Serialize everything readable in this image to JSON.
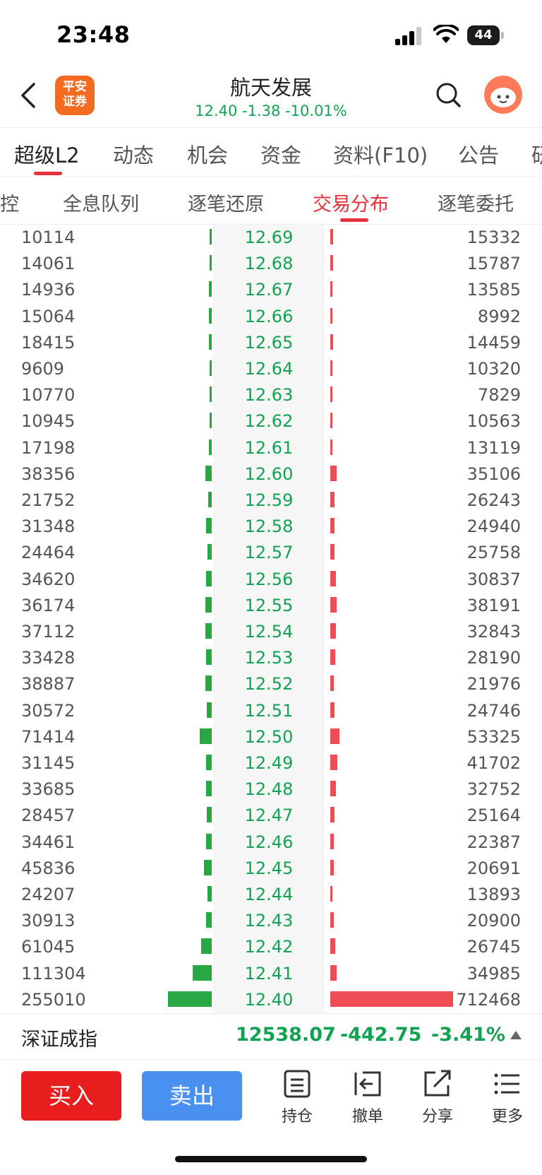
{
  "status_bar": {
    "time": "23:48",
    "battery": "44"
  },
  "header": {
    "logo_line1": "平安",
    "logo_line2": "证券",
    "title": "航天发展",
    "subtitle": "12.40 -1.38 -10.01%"
  },
  "tabs_primary": [
    "超级L2",
    "动态",
    "机会",
    "资金",
    "资料(F10)",
    "公告",
    "研"
  ],
  "tabs_secondary": [
    "控",
    "全息队列",
    "逐笔还原",
    "交易分布",
    "逐笔委托"
  ],
  "distribution": {
    "rows": [
      {
        "buy": "10114",
        "price": "12.69",
        "sell": "15332"
      },
      {
        "buy": "14061",
        "price": "12.68",
        "sell": "15787"
      },
      {
        "buy": "14936",
        "price": "12.67",
        "sell": "13585"
      },
      {
        "buy": "15064",
        "price": "12.66",
        "sell": "8992"
      },
      {
        "buy": "18415",
        "price": "12.65",
        "sell": "14459"
      },
      {
        "buy": "9609",
        "price": "12.64",
        "sell": "10320"
      },
      {
        "buy": "10770",
        "price": "12.63",
        "sell": "7829"
      },
      {
        "buy": "10945",
        "price": "12.62",
        "sell": "10563"
      },
      {
        "buy": "17198",
        "price": "12.61",
        "sell": "13119"
      },
      {
        "buy": "38356",
        "price": "12.60",
        "sell": "35106"
      },
      {
        "buy": "21752",
        "price": "12.59",
        "sell": "26243"
      },
      {
        "buy": "31348",
        "price": "12.58",
        "sell": "24940"
      },
      {
        "buy": "24464",
        "price": "12.57",
        "sell": "25758"
      },
      {
        "buy": "34620",
        "price": "12.56",
        "sell": "30837"
      },
      {
        "buy": "36174",
        "price": "12.55",
        "sell": "38191"
      },
      {
        "buy": "37112",
        "price": "12.54",
        "sell": "32843"
      },
      {
        "buy": "33428",
        "price": "12.53",
        "sell": "28190"
      },
      {
        "buy": "38887",
        "price": "12.52",
        "sell": "21976"
      },
      {
        "buy": "30572",
        "price": "12.51",
        "sell": "24746"
      },
      {
        "buy": "71414",
        "price": "12.50",
        "sell": "53325"
      },
      {
        "buy": "31145",
        "price": "12.49",
        "sell": "41702"
      },
      {
        "buy": "33685",
        "price": "12.48",
        "sell": "32752"
      },
      {
        "buy": "28457",
        "price": "12.47",
        "sell": "25164"
      },
      {
        "buy": "34461",
        "price": "12.46",
        "sell": "22387"
      },
      {
        "buy": "45836",
        "price": "12.45",
        "sell": "20691"
      },
      {
        "buy": "24207",
        "price": "12.44",
        "sell": "13893"
      },
      {
        "buy": "30913",
        "price": "12.43",
        "sell": "20900"
      },
      {
        "buy": "61045",
        "price": "12.42",
        "sell": "26745"
      },
      {
        "buy": "111304",
        "price": "12.41",
        "sell": "34985"
      },
      {
        "buy": "255010",
        "price": "12.40",
        "sell": "712468"
      }
    ],
    "colors": {
      "buy_bar": "#29a745",
      "sell_bar": "#ee4d55",
      "price": "#13a154"
    }
  },
  "index_bar": {
    "name": "深证成指",
    "value": "12538.07",
    "change": "-442.75",
    "change_pct": "-3.41%"
  },
  "toolbar": {
    "buy_label": "买入",
    "sell_label": "卖出",
    "hold_label": "持仓",
    "cancel_label": "撤单",
    "share_label": "分享",
    "more_label": "更多"
  },
  "colors": {
    "accent_red": "#e8303c",
    "down_green": "#13a154",
    "buy_button": "#e81e1e",
    "sell_button": "#4a90f0"
  }
}
